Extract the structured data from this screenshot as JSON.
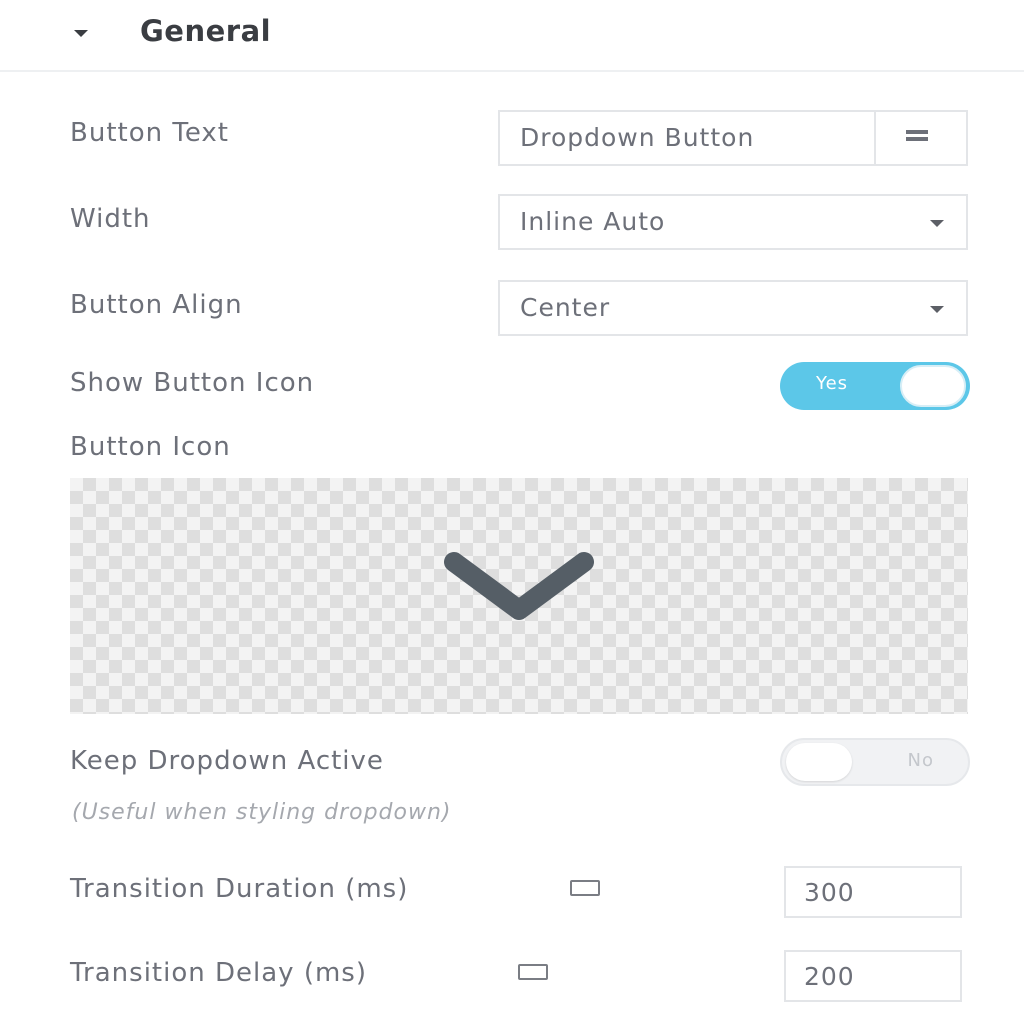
{
  "section": {
    "title": "General"
  },
  "fields": {
    "button_text": {
      "label": "Button Text",
      "value": "Dropdown Button"
    },
    "width": {
      "label": "Width",
      "value": "Inline Auto"
    },
    "button_align": {
      "label": "Button Align",
      "value": "Center"
    },
    "show_button_icon": {
      "label": "Show Button Icon",
      "state": "Yes"
    },
    "button_icon": {
      "label": "Button Icon",
      "icon": "chevron-down-icon"
    },
    "keep_dropdown_active": {
      "label": "Keep Dropdown Active",
      "state": "No",
      "hint": "(Useful when styling dropdown)"
    },
    "transition_duration": {
      "label": "Transition Duration (ms)",
      "value": "300"
    },
    "transition_delay": {
      "label": "Transition Delay (ms)",
      "value": "200"
    }
  },
  "colors": {
    "toggle_on": "#5cc7e8",
    "chevron": "#555e66"
  }
}
